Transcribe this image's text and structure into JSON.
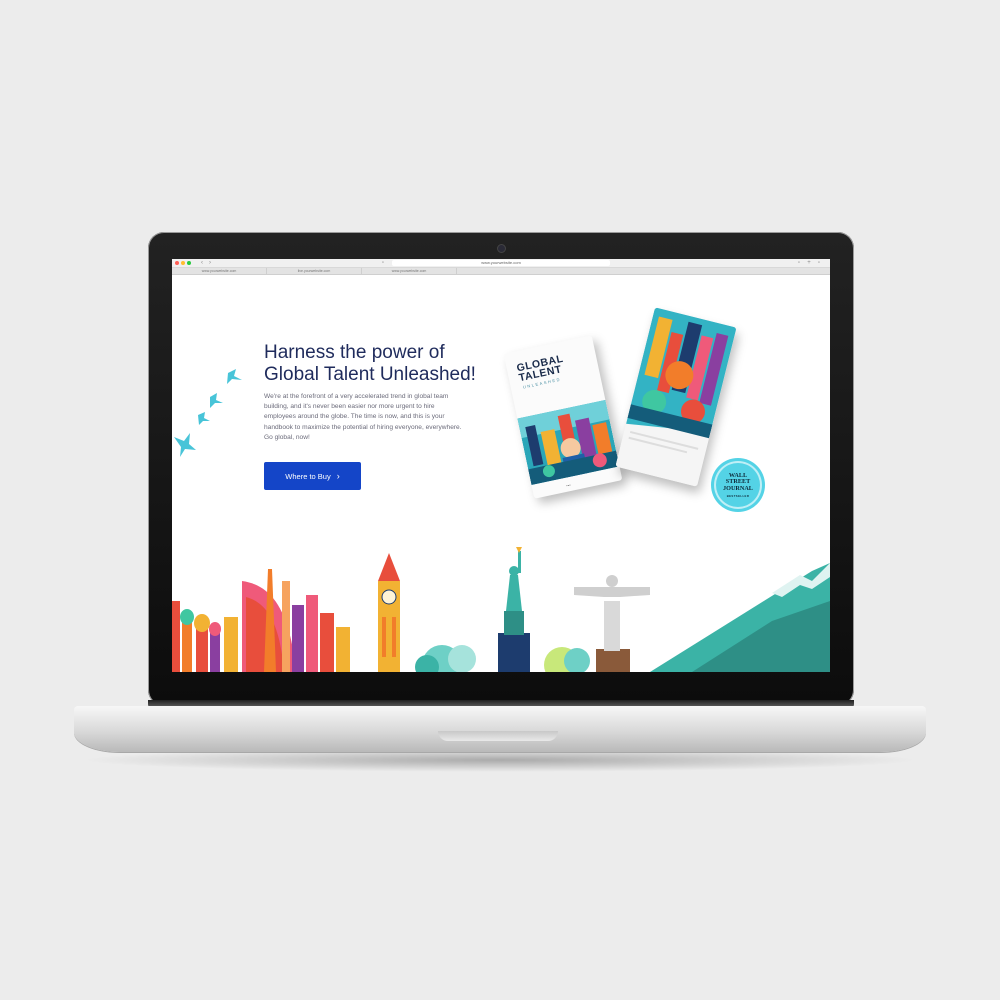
{
  "browser": {
    "url": "www.yourwebsite.com",
    "tabs": [
      "www.yourwebsite.com",
      "live.yourwebsite.com",
      "www.yourwebsite.com"
    ]
  },
  "hero": {
    "headline_line1": "Harness the power of",
    "headline_line2": "Global Talent Unleashed!",
    "body": "We're at the forefront of a very accelerated trend in global team building, and it's never been easier nor more urgent to hire employees around the globe. The time is now, and this is your handbook to maximize the potential of hiring everyone, everywhere. Go global, now!",
    "cta_label": "Where to Buy",
    "cta_icon": "chevron-right-icon"
  },
  "book": {
    "title_line1": "GLOBAL",
    "title_line2": "TALENT",
    "subtitle": "UNLEASHED"
  },
  "badge": {
    "line1": "WALL",
    "line2": "STREET",
    "line3": "JOURNAL",
    "line4": "BESTSELLER"
  },
  "colors": {
    "headline": "#1f2b5c",
    "cta_background": "#1445c8",
    "seal": "#54d3e6",
    "bird": "#48c4d8",
    "mountain": "#3bb3a6"
  }
}
